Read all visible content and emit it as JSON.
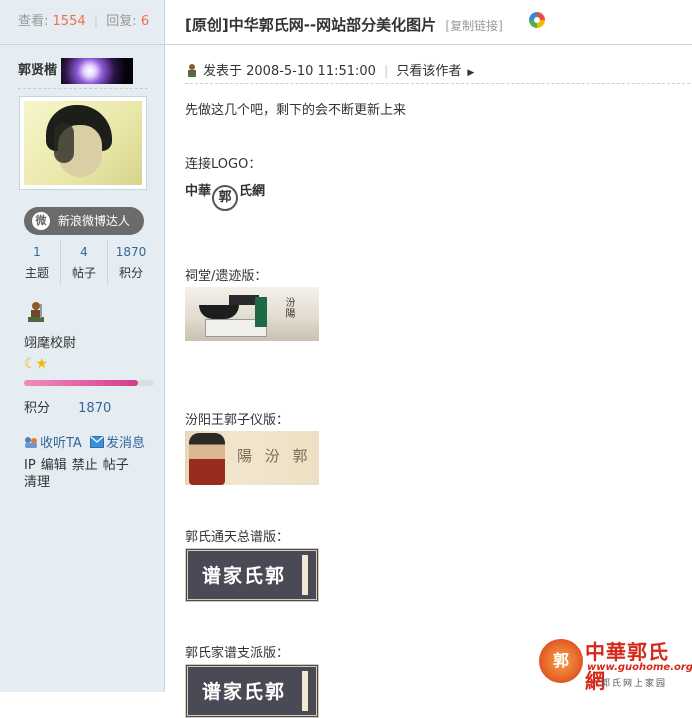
{
  "sidebar": {
    "stats": {
      "views_label": "查看:",
      "views": "1554",
      "replies_label": "回复:",
      "replies": "6"
    },
    "username": "郭贤楷",
    "weibo_badge": "新浪微博达人",
    "counts": [
      {
        "value": "1",
        "label": "主题"
      },
      {
        "value": "4",
        "label": "帖子"
      },
      {
        "value": "1870",
        "label": "积分"
      }
    ],
    "rank": "翊麾校尉",
    "level_progress": 0.88,
    "points_label": "积分",
    "points_value": "1870",
    "actions": {
      "listen": "收听TA",
      "message": "发消息"
    },
    "admin_links": [
      "IP",
      "编辑",
      "禁止",
      "帖子",
      "清理"
    ]
  },
  "post": {
    "title": "[原创]中华郭氏网--网站部分美化图片",
    "copy_link": "[复制链接]",
    "posted_label": "发表于 2008-5-10 11:51:00",
    "only_author": "只看该作者",
    "intro": "先做这几个吧，剩下的会不断更新上来",
    "sections": {
      "logo": "连接LOGO：",
      "ancestral": "祠堂/遗迹版：",
      "fenyang": "汾阳王郭子仪版：",
      "general": "郭氏通天总谱版：",
      "branch": "郭氏家谱支派版："
    },
    "logo_text": {
      "a": "中華",
      "b": "郭",
      "c": "氏網"
    },
    "banner_general_text": "谱家氏郭",
    "banner_branch_text": "谱家氏郭",
    "banner_fenyang_text": "陽 汾 郭",
    "banner_ancestral_text": "汾陽"
  },
  "watermark": {
    "seal": "郭",
    "title": "中華郭氏網",
    "url": "www.guohome.org",
    "subtitle": "郭氏网上家园"
  },
  "colors": {
    "accent_orange": "#f26c4f",
    "link_blue": "#336699",
    "sidebar_bg": "#e5edf2",
    "watermark_red": "#d6281a"
  }
}
